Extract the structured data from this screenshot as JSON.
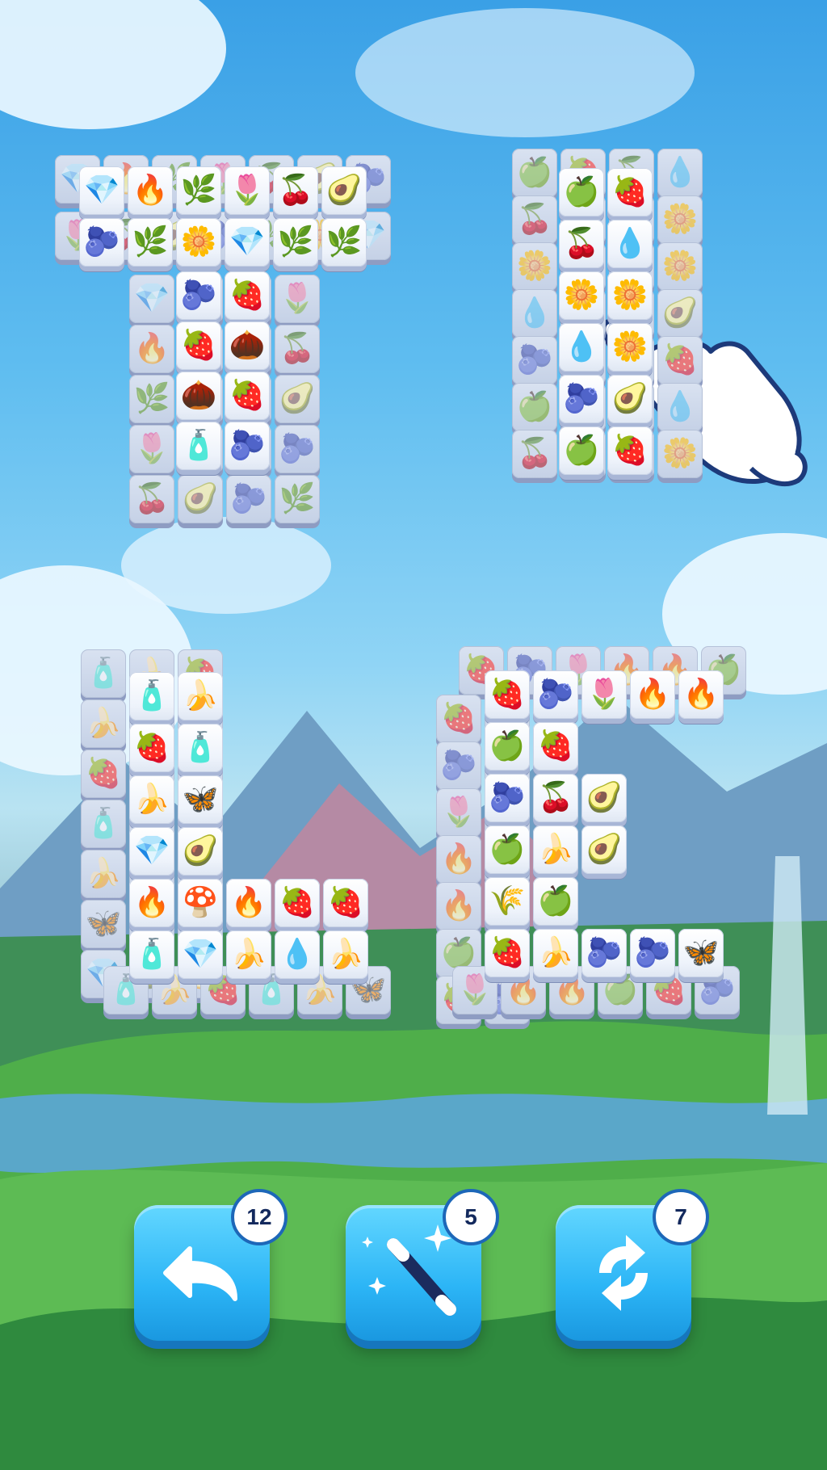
{
  "boosters": {
    "undo": {
      "count": "12",
      "icon": "undo-arrow-icon"
    },
    "hint": {
      "count": "5",
      "icon": "magic-wand-icon"
    },
    "shuffle": {
      "count": "7",
      "icon": "shuffle-arrows-icon"
    }
  },
  "colors": {
    "sky": "#3aa0e6",
    "button": "#2cb5f6",
    "badge_border": "#1d67b8",
    "grass": "#4fae4a"
  },
  "tiles": {
    "group_t": [
      "💎",
      "🔥",
      "🌿",
      "🌷",
      "🍒",
      "🥑",
      "🫐",
      "🌿",
      "🌼",
      "💎",
      "🌿",
      "🌿",
      "🫐",
      "🍓",
      "🍓",
      "🌰",
      "🌰",
      "🍓",
      "🧴",
      "🫐"
    ],
    "group_i": [
      "🍏",
      "🍓",
      "🍒",
      "💧",
      "🌼",
      "🌼",
      "💧",
      "🌼",
      "🫐",
      "🥑"
    ],
    "group_l": [
      "🧴",
      "🍌",
      "🍓",
      "🧴",
      "🍌",
      "🦋",
      "💎",
      "🥑",
      "🔥",
      "🍄",
      "🔥",
      "🍓",
      "🍓",
      "🧴",
      "💎",
      "🍌",
      "💧",
      "🍌"
    ],
    "group_e": [
      "🍓",
      "🫐",
      "🌷",
      "🔥",
      "🔥",
      "🍏",
      "🍓",
      "🫐",
      "🍒",
      "🍏",
      "🍌",
      "🌾",
      "🍏",
      "🥑",
      "🥑",
      "🍓",
      "🍌",
      "🫐",
      "🫐",
      "🦋"
    ]
  }
}
